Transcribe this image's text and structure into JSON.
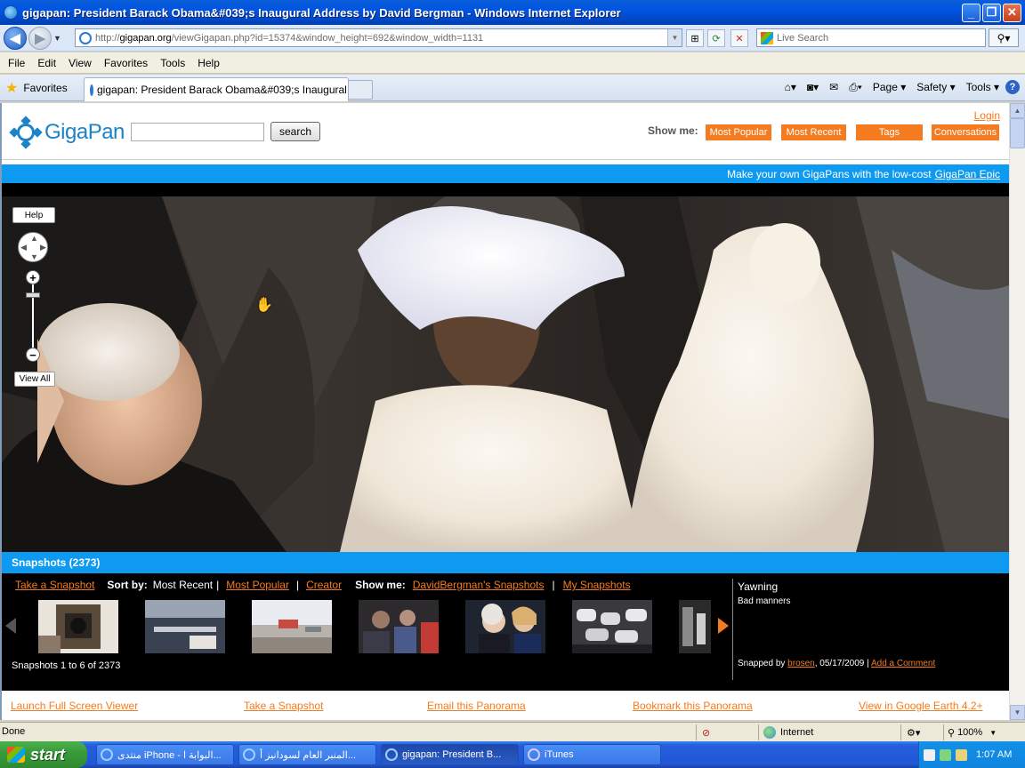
{
  "window": {
    "title": "gigapan: President Barack Obama&#039;s Inaugural Address by David Bergman - Windows Internet Explorer",
    "minimize": "_",
    "maximize": "❐",
    "close": "✕"
  },
  "address": {
    "url_prefix": "http://",
    "url_host": "gigapan.org",
    "url_path": "/viewGigapan.php?id=15374&window_height=692&window_width=1131",
    "search_placeholder": "Live Search"
  },
  "menu": [
    "File",
    "Edit",
    "View",
    "Favorites",
    "Tools",
    "Help"
  ],
  "tabs": {
    "favorites_label": "Favorites",
    "active_tab": "gigapan: President Barack Obama&#039;s Inaugural ...",
    "commands": [
      "Page ▾",
      "Safety ▾",
      "Tools ▾"
    ]
  },
  "site": {
    "logo": "GigaPan",
    "search_button": "search",
    "login": "Login",
    "show_me_label": "Show me:",
    "show_me_buttons": [
      "Most Popular",
      "Most Recent",
      "Tags",
      "Conversations"
    ],
    "promo_text": "Make your own GigaPans with the low-cost",
    "promo_link": "GigaPan Epic"
  },
  "viewer": {
    "help": "Help",
    "view_all": "View All",
    "zoom_in": "+",
    "zoom_out": "−"
  },
  "snapshots": {
    "header": "Snapshots (2373)",
    "take_snapshot": "Take a Snapshot",
    "sort_by_label": "Sort by:",
    "sort_current": "Most Recent",
    "sort_popular": "Most Popular",
    "sort_creator": "Creator",
    "sep": "|",
    "show_me_label": "Show me:",
    "show_user": "DavidBergman's Snapshots",
    "show_mine": "My Snapshots",
    "count_text": "Snapshots 1 to 6 of 2373",
    "detail": {
      "title": "Yawning",
      "description": "Bad manners",
      "snapped_by_label": "Snapped by",
      "user": "brosen",
      "date": ", 05/17/2009 |",
      "comment_link": "Add a Comment"
    }
  },
  "footer_links": [
    "Launch Full Screen Viewer",
    "Take a Snapshot",
    "Email this Panorama",
    "Bookmark this Panorama",
    "View in Google Earth 4.2+"
  ],
  "status": {
    "text": "Done",
    "zone": "Internet",
    "zoom": "100%"
  },
  "taskbar": {
    "start": "start",
    "items": [
      "منتدى iPhone - البوابة ا...",
      "المنبر العام لسودانيز أ...",
      "gigapan: President B...",
      "iTunes"
    ],
    "clock": "1:07 AM"
  },
  "colors": {
    "accent_orange": "#f47b20",
    "accent_blue": "#0d9af0",
    "logo_blue": "#1b83c6"
  }
}
